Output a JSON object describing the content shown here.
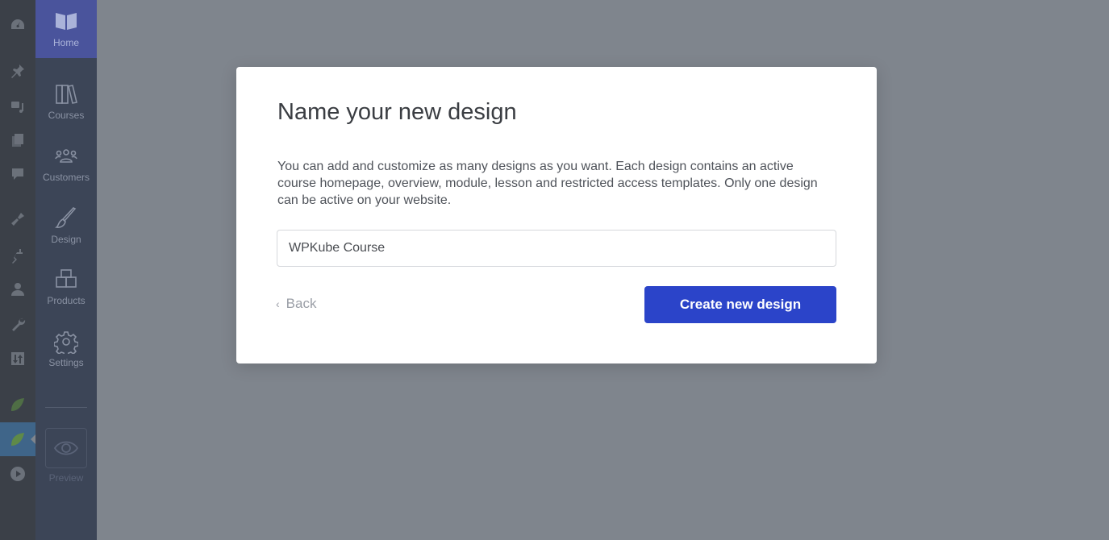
{
  "admin_bar": {
    "icons": [
      "dashboard-icon",
      "pin-icon",
      "media-icon",
      "pages-icon",
      "comments-icon",
      "appearance-icon",
      "plugins-icon",
      "users-icon",
      "tools-icon",
      "settings-sliders-icon",
      "leaf-icon",
      "leaf-active-icon",
      "play-icon"
    ]
  },
  "plugin_sidebar": {
    "items": [
      {
        "label": "Home",
        "icon": "book-leaf-icon",
        "active": true
      },
      {
        "label": "Courses",
        "icon": "books-icon"
      },
      {
        "label": "Customers",
        "icon": "people-icon"
      },
      {
        "label": "Design",
        "icon": "brush-icon"
      },
      {
        "label": "Products",
        "icon": "boxes-icon"
      },
      {
        "label": "Settings",
        "icon": "gear-icon"
      }
    ],
    "preview_label": "Preview"
  },
  "modal": {
    "title": "Name your new design",
    "description": "You can add and customize as many designs as you want. Each design contains an active course homepage, overview, module, lesson and restricted access templates. Only one design can be active on your website.",
    "input_value": "WPKube Course",
    "back_label": "Back",
    "create_label": "Create new design"
  },
  "colors": {
    "primary": "#2b44c9",
    "overlay": "#7f858d",
    "sidebar": "#3c4557",
    "active_item": "#4a549c"
  }
}
